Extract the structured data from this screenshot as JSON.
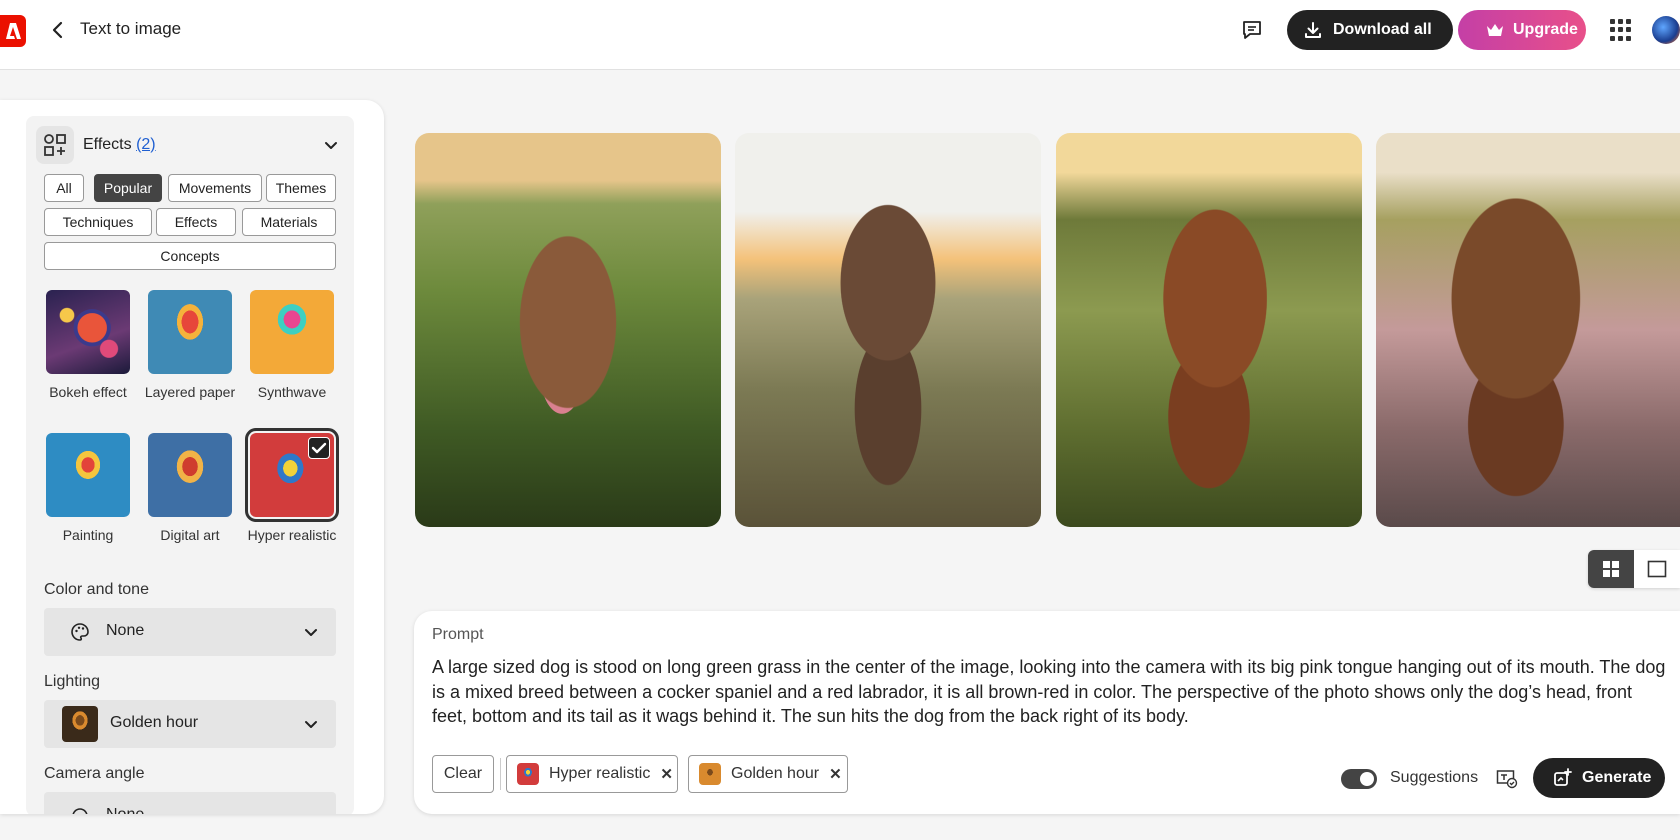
{
  "header": {
    "page_title": "Text to image",
    "download_label": "Download all",
    "upgrade_label": "Upgrade"
  },
  "effects": {
    "title": "Effects",
    "count": "(2)",
    "filters": [
      "All",
      "Popular",
      "Movements",
      "Themes",
      "Techniques",
      "Effects",
      "Materials",
      "Concepts"
    ],
    "active_filter": "Popular",
    "styles": [
      {
        "label": "Bokeh effect",
        "selected": false
      },
      {
        "label": "Layered paper",
        "selected": false
      },
      {
        "label": "Synthwave",
        "selected": false
      },
      {
        "label": "Painting",
        "selected": false
      },
      {
        "label": "Digital art",
        "selected": false
      },
      {
        "label": "Hyper realistic",
        "selected": true
      }
    ]
  },
  "color_tone": {
    "label": "Color and tone",
    "value": "None"
  },
  "lighting": {
    "label": "Lighting",
    "value": "Golden hour"
  },
  "camera_angle": {
    "label": "Camera angle",
    "value": "None"
  },
  "gallery": {
    "images": [
      {
        "alt": "Brown dog with pink tongue standing in grass"
      },
      {
        "alt": "Brown dog in field at sunset"
      },
      {
        "alt": "Red spaniel dog in tall grass"
      },
      {
        "alt": "Brown spaniel dog in meadow"
      }
    ]
  },
  "prompt": {
    "label": "Prompt",
    "text": "A large sized dog is stood on long green grass in the center of the image, looking into the camera with its big pink tongue hanging out of its mouth. The dog is a mixed breed between a cocker spaniel and a red labrador, it is all brown-red in color. The perspective of the photo shows only the dog’s head, front feet, bottom and its tail as it wags behind it. The sun hits the dog from the back right of its body.",
    "clear_label": "Clear",
    "tags": [
      "Hyper realistic",
      "Golden hour"
    ],
    "suggestions_label": "Suggestions",
    "generate_label": "Generate"
  },
  "colors": {
    "accent_link": "#1f5fd1",
    "upgrade_gradient_start": "#c43fa6",
    "upgrade_gradient_end": "#e8508a",
    "logo": "#eb1000"
  }
}
